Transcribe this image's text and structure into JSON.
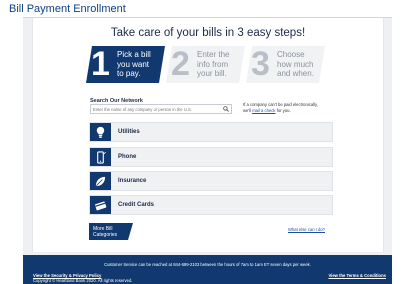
{
  "page": {
    "title": "Bill Payment Enrollment"
  },
  "header": {
    "headline": "Take care of your bills in 3 easy steps!"
  },
  "steps": [
    {
      "number": "1",
      "line1": "Pick a bill",
      "line2": "you want",
      "line3": "to pay."
    },
    {
      "number": "2",
      "line1": "Enter the",
      "line2": "info from",
      "line3": "your bill."
    },
    {
      "number": "3",
      "line1": "Choose",
      "line2": "how much",
      "line3": "and when."
    }
  ],
  "search": {
    "label": "Search Our Network",
    "placeholder": "Enter the name of any company or person in the U.S.",
    "note_line1": "If a company can't be paid electronically,",
    "note_prefix": "we'll",
    "note_link": "mail a check",
    "note_suffix": "for you."
  },
  "categories": [
    {
      "label": "Utilities",
      "icon": "utilities-icon"
    },
    {
      "label": "Phone",
      "icon": "phone-icon"
    },
    {
      "label": "Insurance",
      "icon": "insurance-icon"
    },
    {
      "label": "Credit Cards",
      "icon": "credit-card-icon"
    }
  ],
  "more_button": {
    "line1": "More Bill",
    "line2": "Categories"
  },
  "what_link": "What else can I do?",
  "footer": {
    "customer_service": "Customer Service can be reached at 844-699-2103 between the hours of 7am to 1am ET seven days per week.",
    "security_link": "View the Security & Privacy Policy",
    "copyright": "Copyright © Heartland Bank 2020. All rights reserved.",
    "terms_link": "View the Terms & Conditions"
  },
  "colors": {
    "brand_navy": "#11386f",
    "title_blue": "#0d3f86",
    "link_blue": "#1a4ea0"
  }
}
